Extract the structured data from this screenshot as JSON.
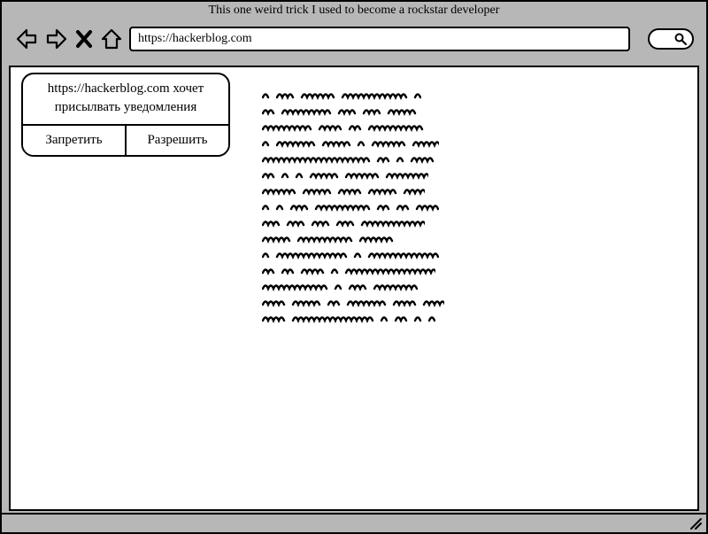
{
  "window": {
    "title": "This one weird trick I used to become a rockstar developer"
  },
  "browser": {
    "url": "https://hackerblog.com"
  },
  "permission_dialog": {
    "line1": "https://hackerblog.com хочет",
    "line2": "присылвать уведомления",
    "deny_label": "Запретить",
    "allow_label": "Разрешить"
  }
}
